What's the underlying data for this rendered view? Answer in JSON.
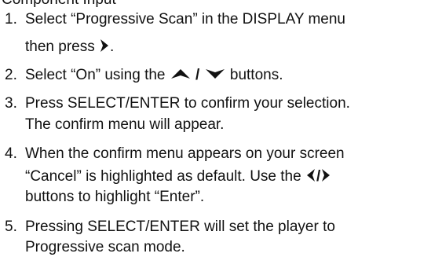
{
  "header_partial": "Component Input",
  "steps": [
    {
      "number": "1.",
      "line1": "Select “Progressive Scan” in the DISPLAY menu",
      "line2_before": "then press ",
      "line2_after": ".",
      "icons": [
        "right-arrow-icon"
      ]
    },
    {
      "number": "2.",
      "line1_before": "Select “On” using the ",
      "line1_sep": " / ",
      "line1_after": " buttons.",
      "icons": [
        "up-arrow-icon",
        "down-arrow-icon"
      ]
    },
    {
      "number": "3.",
      "line1": "Press SELECT/ENTER to confirm your selection.",
      "line2": "The confirm menu will appear."
    },
    {
      "number": "4.",
      "line1": "When the confirm menu appears on your screen",
      "line2_before": "“Cancel” is highlighted as default. Use the ",
      "line2_sep": "/",
      "line3": "buttons to highlight “Enter”.",
      "icons": [
        "left-arrow-icon",
        "right-arrow-icon"
      ]
    },
    {
      "number": "5.",
      "line1": "Pressing SELECT/ENTER will set the player to",
      "line2": "Progressive scan mode."
    }
  ]
}
